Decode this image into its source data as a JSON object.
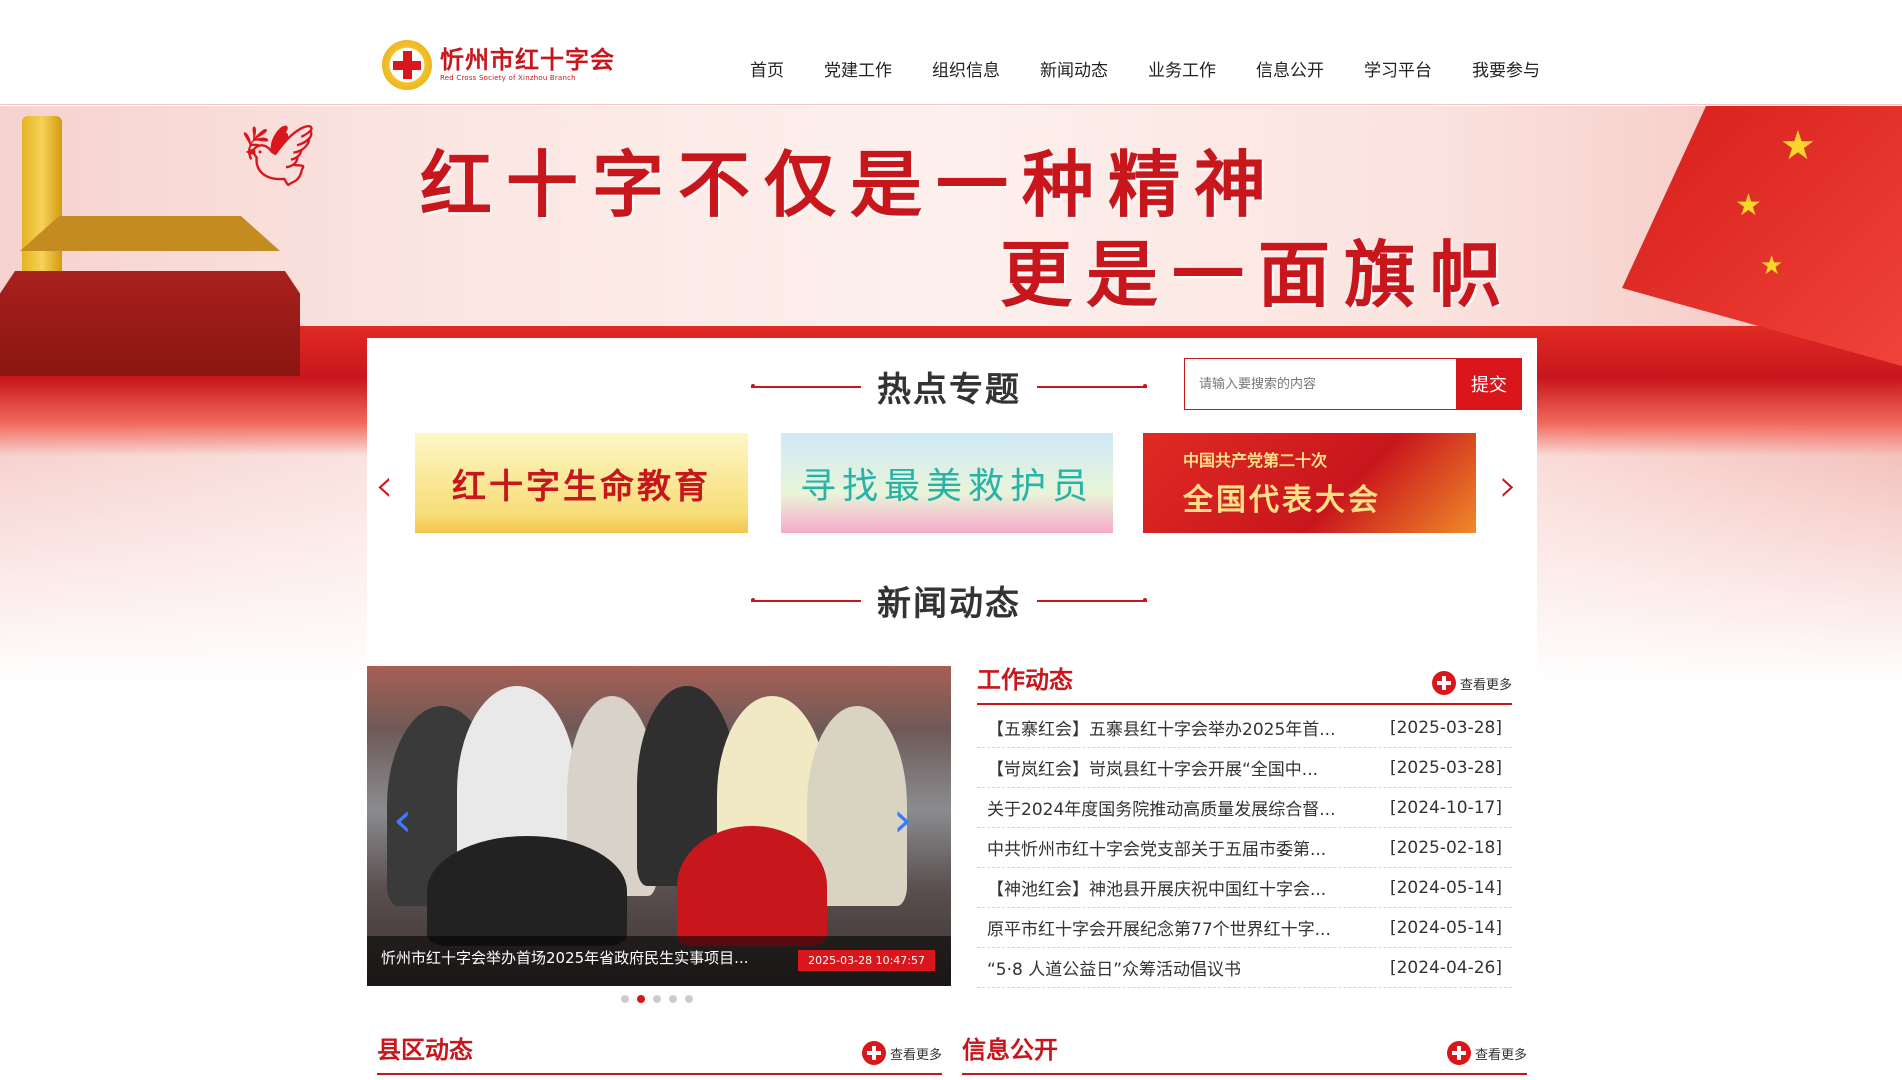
{
  "header": {
    "logo_title": "忻州市红十字会",
    "logo_subtitle": "Red Cross Society of Xinzhou Branch",
    "nav": [
      "首页",
      "党建工作",
      "组织信息",
      "新闻动态",
      "业务工作",
      "信息公开",
      "学习平台",
      "我要参与"
    ]
  },
  "banner": {
    "line1": "红十字不仅是一种精神",
    "line2": "更是一面旗帜"
  },
  "hot_topics": {
    "title": "热点专题",
    "search_placeholder": "请输入要搜索的内容",
    "search_button": "提交",
    "items": [
      {
        "text": "红十字生命教育"
      },
      {
        "text": "寻找最美救护员"
      },
      {
        "small": "中国共产党第二十次",
        "big": "全国代表大会"
      }
    ]
  },
  "news": {
    "title": "新闻动态",
    "slider": {
      "caption": "忻州市红十字会举办首场2025年省政府民生实事项目...",
      "time": "2025-03-28 10:47:57",
      "slide_count": 5,
      "active_slide": 2
    },
    "work": {
      "title": "工作动态",
      "more": "查看更多",
      "items": [
        {
          "title": "【五寨红会】五寨县红十字会举办2025年首...",
          "date": "[2025-03-28]"
        },
        {
          "title": "【岢岚红会】岢岚县红十字会开展“全国中...",
          "date": "[2025-03-28]"
        },
        {
          "title": "关于2024年度国务院推动高质量发展综合督...",
          "date": "[2024-10-17]"
        },
        {
          "title": "中共忻州市红十字会党支部关于五届市委第...",
          "date": "[2025-02-18]"
        },
        {
          "title": "【神池红会】神池县开展庆祝中国红十字会...",
          "date": "[2024-05-14]"
        },
        {
          "title": "原平市红十字会开展纪念第77个世界红十字...",
          "date": "[2024-05-14]"
        },
        {
          "title": "“5·8 人道公益日”众筹活动倡议书",
          "date": "[2024-04-26]"
        }
      ]
    }
  },
  "county": {
    "title": "县区动态",
    "more": "查看更多"
  },
  "info": {
    "title": "信息公开",
    "more": "查看更多"
  },
  "colors": {
    "brand_red": "#c8161d",
    "button_red": "#d8161b"
  }
}
